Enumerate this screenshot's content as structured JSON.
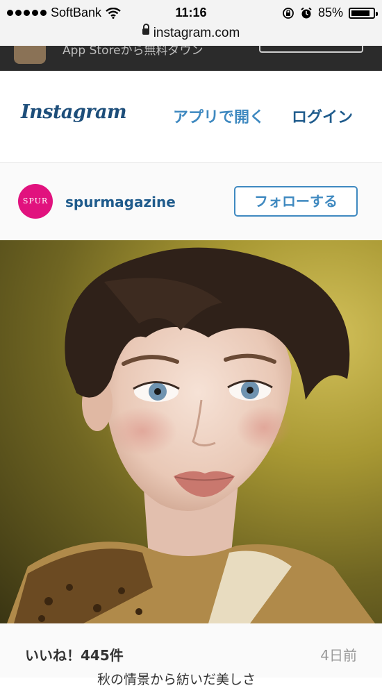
{
  "status_bar": {
    "carrier": "SoftBank",
    "time": "11:16",
    "battery": "85%",
    "battery_level": 0.85
  },
  "url_bar": {
    "domain": "instagram.com"
  },
  "app_banner": {
    "text": "App Storeから無料ダウン"
  },
  "header": {
    "logo": "Instagram",
    "open_app": "アプリで開く",
    "login": "ログイン"
  },
  "profile": {
    "avatar_text": "SPUR",
    "username": "spurmagazine",
    "follow": "フォローする"
  },
  "post": {
    "likes": "いいね！445件",
    "time_ago": "4日前",
    "caption": "秋の情景から紡いだ美しさ"
  },
  "icons": [
    "wifi-icon",
    "lock-icon",
    "rotation-lock-icon",
    "alarm-icon",
    "battery-icon"
  ]
}
